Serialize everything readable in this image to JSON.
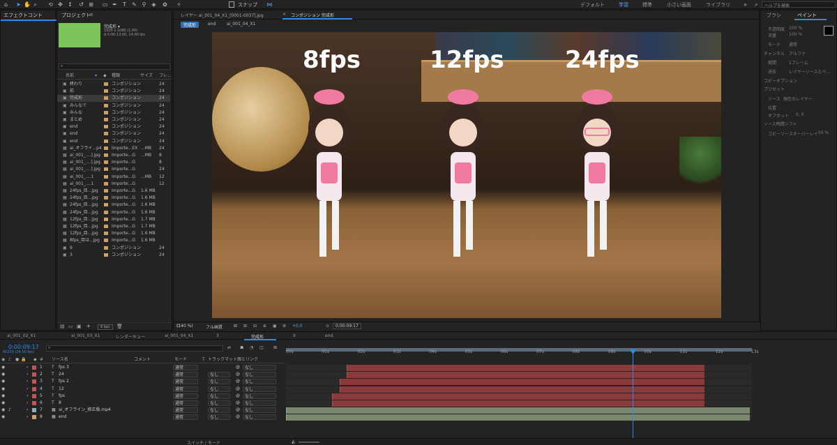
{
  "topbar": {
    "snap_label": "スナップ",
    "workspaces": [
      "デフォルト",
      "学習",
      "標準",
      "小さい画面",
      "ライブラリ"
    ],
    "search_placeholder": "ヘルプを検索"
  },
  "left_panel": {
    "title": "エフェクトコント"
  },
  "project": {
    "title": "プロジェクト",
    "comp_name": "完成形 ▾",
    "comp_info1": "1920 x 1080 (1.00)",
    "comp_info2": "Δ 0:00:13:00, 24.00 fps",
    "search_placeholder": "",
    "columns": {
      "name": "名前",
      "type": "種類",
      "size": "サイズ",
      "rate": "フレ..."
    },
    "items": [
      {
        "name": "終わり",
        "type": "コンポジション",
        "size": "",
        "rate": "24"
      },
      {
        "name": "前",
        "type": "コンポジション",
        "size": "",
        "rate": "24"
      },
      {
        "name": "完成形",
        "type": "コンポジション",
        "size": "",
        "rate": "24"
      },
      {
        "name": "みんなで",
        "type": "コンポジション",
        "size": "",
        "rate": "24"
      },
      {
        "name": "みんな",
        "type": "コンポジション",
        "size": "",
        "rate": "24"
      },
      {
        "name": "まとめ",
        "type": "コンポジション",
        "size": "",
        "rate": "24"
      },
      {
        "name": "end",
        "type": "コンポジション",
        "size": "",
        "rate": "24"
      },
      {
        "name": "end",
        "type": "コンポジション",
        "size": "",
        "rate": "24"
      },
      {
        "name": "end",
        "type": "コンポジション",
        "size": "",
        "rate": "24"
      },
      {
        "name": "ai_オフライ...p4",
        "type": "Importe...EX",
        "size": "...MB",
        "rate": "24"
      },
      {
        "name": "ai_001_....].jpg",
        "type": "Importe...G",
        "size": "...MB",
        "rate": "8"
      },
      {
        "name": "ai_001_....].jpg",
        "type": "Importe...G",
        "size": "",
        "rate": "8"
      },
      {
        "name": "ai_001_....].jpg",
        "type": "Importe...G",
        "size": "",
        "rate": "24"
      },
      {
        "name": "ai_001_....1",
        "type": "Importe...G",
        "size": "...MB",
        "rate": "12"
      },
      {
        "name": "ai_001_....1",
        "type": "Importe...G",
        "size": "",
        "rate": "12"
      },
      {
        "name": "24fps_目...jpg",
        "type": "Importe...G",
        "size": "1.6 MB",
        "rate": ""
      },
      {
        "name": "24fps_目...jpg",
        "type": "Importe...G",
        "size": "1.6 MB",
        "rate": ""
      },
      {
        "name": "24fps_目...jpg",
        "type": "Importe...G",
        "size": "1.6 MB",
        "rate": ""
      },
      {
        "name": "24fps_目...jpg",
        "type": "Importe...G",
        "size": "1.6 MB",
        "rate": ""
      },
      {
        "name": "12fps_目...jpg",
        "type": "Importe...G",
        "size": "1.7 MB",
        "rate": ""
      },
      {
        "name": "12fps_目...jpg",
        "type": "Importe...G",
        "size": "1.7 MB",
        "rate": ""
      },
      {
        "name": "12fps_目...jpg",
        "type": "Importe...G",
        "size": "1.6 MB",
        "rate": ""
      },
      {
        "name": "8fps_目は...jpg",
        "type": "Importe...G",
        "size": "1.6 MB",
        "rate": ""
      },
      {
        "name": "9",
        "type": "コンポジション",
        "size": "",
        "rate": "24"
      },
      {
        "name": "3",
        "type": "コンポジション",
        "size": "",
        "rate": "24"
      }
    ],
    "bpc": "8 bpc"
  },
  "viewer": {
    "tabs": [
      "レイヤー ai_001_04_X1_[0001-0037].jpg",
      "コンポジション 完成形"
    ],
    "breadcrumbs": [
      "完成形",
      "end",
      "ai_001_04_X1"
    ],
    "overlay": [
      "8fps",
      "12fps",
      "24fps"
    ],
    "zoom": "(140 %)",
    "quality": "フル画質",
    "exposure": "+0.0",
    "timecode": "0:00:09:17"
  },
  "right_panel": {
    "tabs": [
      "ブラシ",
      "ペイント"
    ],
    "labels": [
      "不透明度",
      "流量",
      "モード",
      "チャンネル",
      "期間",
      "消去",
      "コピーオプション",
      "プリセット",
      "ソース",
      "位置",
      "オフセット",
      "ソース時間シフト",
      "コピーソースオーバーレイ"
    ],
    "values": [
      "100 %",
      "100 %",
      "通常",
      "アルファ",
      "1フレーム",
      "レイヤーソースとペ...",
      "現在のレイヤー",
      "0, 0",
      "50 %"
    ]
  },
  "timeline": {
    "tabs": [
      "ai_001_02_X1",
      "ai_001_03_X1",
      "レンダーキュー",
      "ai_001_04_X1",
      "3",
      "完成形",
      "9",
      "end"
    ],
    "time": "0:00:09:17",
    "fps_info": "00233 (24.00 fps)",
    "headers": {
      "src": "ソース名",
      "comment": "コメント",
      "mode": "モード",
      "t": "T",
      "trk": "トラックマット",
      "parent": "親とリンク"
    },
    "ruler": [
      "00s",
      "01s",
      "02s",
      "03s",
      "04s",
      "05s",
      "06s",
      "07s",
      "08s",
      "09s",
      "10s",
      "11s",
      "12s",
      "13s"
    ],
    "layers": [
      {
        "num": "1",
        "name": "fps 3",
        "mode": "通常",
        "trk": "",
        "parent": "なし"
      },
      {
        "num": "2",
        "name": "24",
        "mode": "通常",
        "trk": "なし",
        "parent": "なし"
      },
      {
        "num": "3",
        "name": "fps 2",
        "mode": "通常",
        "trk": "なし",
        "parent": "なし"
      },
      {
        "num": "4",
        "name": "12",
        "mode": "通常",
        "trk": "なし",
        "parent": "なし"
      },
      {
        "num": "5",
        "name": "fps",
        "mode": "通常",
        "trk": "なし",
        "parent": "なし"
      },
      {
        "num": "6",
        "name": "8",
        "mode": "通常",
        "trk": "なし",
        "parent": "なし"
      },
      {
        "num": "7",
        "name": "ai_オフライン_修正版.mp4",
        "mode": "通常",
        "trk": "なし",
        "parent": "なし"
      },
      {
        "num": "8",
        "name": "end",
        "mode": "通常",
        "trk": "なし",
        "parent": "なし"
      }
    ],
    "bottom_label": "スイッチ / モード"
  },
  "colors": {
    "accent": "#2d8ceb",
    "layer_red": "#8a3a3a",
    "layer_green": "#7a8870",
    "comp_green": "#7ec45c"
  }
}
